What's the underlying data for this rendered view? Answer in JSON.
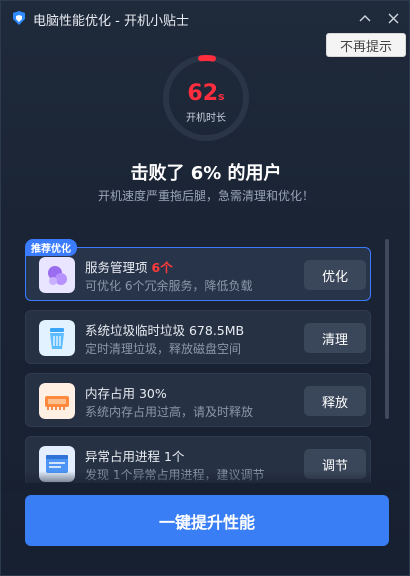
{
  "window": {
    "title": "电脑性能优化 - 开机小贴士",
    "tooltip_button": "不再提示"
  },
  "gauge": {
    "value": "62",
    "unit": "s",
    "label": "开机时长",
    "accent_color": "#ff2e3f"
  },
  "summary": {
    "headline": "击败了 6% 的用户",
    "subline": "开机速度严重拖后腿，急需清理和优化！"
  },
  "recommend_badge": "推荐优化",
  "items": [
    {
      "title": "服务管理项",
      "highlight": "6个",
      "desc": "可优化 6个冗余服务，降低负载",
      "action": "优化",
      "icon": "service-icon"
    },
    {
      "title": "系统垃圾临时垃圾 678.5MB",
      "highlight": "",
      "desc": "定时清理垃圾，释放磁盘空间",
      "action": "清理",
      "icon": "trash-icon"
    },
    {
      "title": "内存占用 30%",
      "highlight": "",
      "desc": "系统内存占用过高，请及时释放",
      "action": "释放",
      "icon": "memory-icon"
    },
    {
      "title": "异常占用进程 1个",
      "highlight": "",
      "desc": "发现 1个异常占用进程，建议调节",
      "action": "调节",
      "icon": "process-icon"
    }
  ],
  "main_action": "一键提升性能",
  "colors": {
    "primary": "#3a7ef5",
    "danger": "#ff2e3f",
    "background": "#1a2434"
  }
}
